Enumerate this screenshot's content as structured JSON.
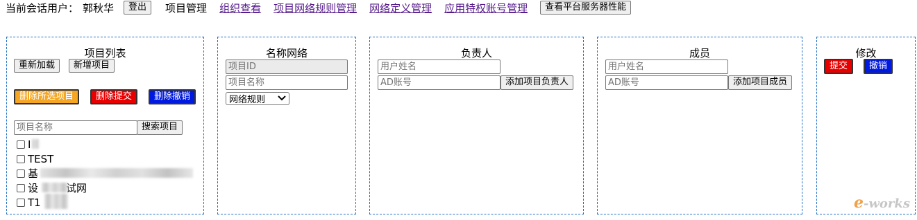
{
  "header": {
    "session_user_label": "当前会话用户：",
    "session_user_name": "郭秋华",
    "logout_label": "登出",
    "project_manage_text": "项目管理",
    "links": [
      "组织查看",
      "项目网络规则管理",
      "网络定义管理",
      "应用特权账号管理"
    ],
    "server_perf_label": "查看平台服务器性能"
  },
  "projects_panel": {
    "title": "项目列表",
    "reload_label": "重新加载",
    "add_label": "新增项目",
    "delete_selected_label": "删除所选项目",
    "delete_submit_label": "删除提交",
    "delete_cancel_label": "删除撤销",
    "search_placeholder": "项目名称",
    "search_label": "搜索项目",
    "items": [
      "I",
      "TEST",
      "基",
      "设",
      "试网",
      "T1"
    ]
  },
  "network_panel": {
    "title": "名称网络",
    "project_id_placeholder": "项目ID",
    "project_name_placeholder": "项目名称",
    "rule_select_value": "网络规则"
  },
  "owner_panel": {
    "title": "负责人",
    "username_placeholder": "用户姓名",
    "ad_placeholder": "AD账号",
    "add_label": "添加项目负责人"
  },
  "members_panel": {
    "title": "成员",
    "username_placeholder": "用户姓名",
    "ad_placeholder": "AD账号",
    "add_label": "添加项目成员"
  },
  "modify_panel": {
    "title": "修改",
    "submit_label": "提交",
    "cancel_label": "撤销"
  },
  "watermark": {
    "e": "e",
    "rest": "-works"
  },
  "colors": {
    "orange": "#f5a623",
    "red": "#e80000",
    "blue": "#0019e0",
    "panel_border": "#1f6fc5",
    "link": "#551a8b"
  }
}
